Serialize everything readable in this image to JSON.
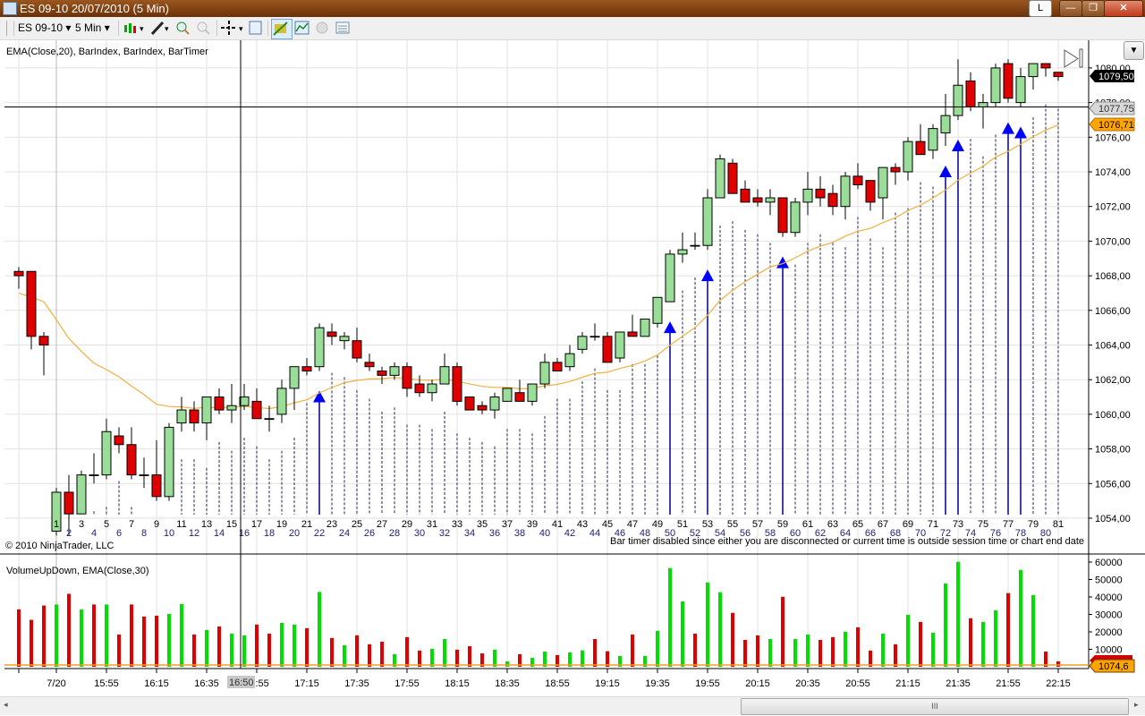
{
  "window": {
    "title": "ES 09-10  20/07/2010 (5 Min)",
    "link_button": "L",
    "minimize": "—",
    "restore": "❐",
    "close": "✕"
  },
  "toolbar": {
    "instrument": "ES 09-10",
    "interval": "5 Min",
    "dropdown_glyph": "▾",
    "icons": [
      "chart-style-icon",
      "drawing-tool-icon",
      "zoom-in-icon",
      "zoom-out-icon",
      "crosshair-icon",
      "properties-icon",
      "strategy-icon",
      "indicators-icon",
      "disabled-circle-icon",
      "data-box-icon"
    ]
  },
  "price_panel": {
    "indicator_label": "EMA(Close,20), BarIndex, BarIndex, BarTimer",
    "copyright": "© 2010 NinjaTrader, LLC",
    "bar_timer_message": "Bar timer disabled since either you are disconnected or current time is outside session time or chart end date",
    "axis_labels": [
      "1054,00",
      "1056,00",
      "1058,00",
      "1060,00",
      "1062,00",
      "1064,00",
      "1066,00",
      "1068,00",
      "1070,00",
      "1072,00",
      "1074,00",
      "1076,00",
      "1078,00",
      "1080,00"
    ],
    "last_price_label": "1079,50",
    "crosshair_price_label": "1077,75",
    "crosshair_price": 1077.75,
    "ema_label": "1076,71",
    "ema_start": 1067.0,
    "ema_period": 20
  },
  "volume_panel": {
    "label": "VolumeUpDown, EMA(Close,30)",
    "axis_labels": [
      "10000",
      "20000",
      "30000",
      "40000",
      "50000",
      "60000"
    ],
    "ema_label": "1074,6"
  },
  "time_axis": {
    "labels": [
      "7/20",
      "15:55",
      "16:15",
      "16:35",
      "16:55",
      "17:15",
      "17:35",
      "17:55",
      "18:15",
      "18:35",
      "18:55",
      "19:15",
      "19:35",
      "19:55",
      "20:15",
      "20:35",
      "20:55",
      "21:15",
      "21:35",
      "21:55",
      "22:15"
    ],
    "crosshair_time_label": "16:50"
  },
  "colors": {
    "up": "#99dd99",
    "down": "#e00000",
    "vol_up": "#00e000",
    "vol_down": "#e00000",
    "ema": "#f0b040",
    "arrow": "#0000ff",
    "title_bar": "#7a3f0c"
  },
  "chart_data": {
    "type": "candlestick",
    "ylim": [
      1053,
      1081
    ],
    "bar_index": [
      null,
      null,
      null,
      1,
      2,
      3,
      4,
      5,
      6,
      7,
      8,
      9,
      10,
      11,
      12,
      13,
      14,
      15,
      16,
      17,
      18,
      19,
      20,
      21,
      22,
      23,
      24,
      25,
      26,
      27,
      28,
      29,
      30,
      31,
      32,
      33,
      34,
      35,
      36,
      37,
      38,
      39,
      40,
      41,
      42,
      43,
      44,
      45,
      46,
      47,
      48,
      49,
      50,
      51,
      52,
      53,
      54,
      55,
      56,
      57,
      58,
      59,
      60,
      61,
      62,
      63,
      64,
      65,
      66,
      67,
      68,
      69,
      70,
      71,
      72,
      73,
      74,
      75,
      76,
      77,
      78,
      79,
      80,
      81
    ],
    "ohlc": [
      [
        1068.25,
        1068.5,
        1067.25,
        1068
      ],
      [
        1068.25,
        1068.25,
        1063.75,
        1064.5
      ],
      [
        1064.5,
        1064.75,
        1062.25,
        1064
      ],
      [
        1053.25,
        1055.75,
        1053,
        1055.5
      ],
      [
        1055.5,
        1056.5,
        1053,
        1054.25
      ],
      [
        1054.25,
        1056.75,
        1054.25,
        1056.5
      ],
      [
        1056.5,
        1057.75,
        1056,
        1056.5
      ],
      [
        1056.5,
        1059.75,
        1056.25,
        1059
      ],
      [
        1058.75,
        1059.25,
        1057.75,
        1058.25
      ],
      [
        1058.25,
        1059.25,
        1056.25,
        1056.5
      ],
      [
        1056.5,
        1057.5,
        1055.75,
        1056.5
      ],
      [
        1056.5,
        1058.5,
        1055,
        1055.25
      ],
      [
        1055.25,
        1059.5,
        1055,
        1059.25
      ],
      [
        1059.5,
        1061,
        1059,
        1060.25
      ],
      [
        1060.25,
        1060.75,
        1059,
        1059.5
      ],
      [
        1059.5,
        1061,
        1058.5,
        1061
      ],
      [
        1061,
        1061.5,
        1060,
        1060.25
      ],
      [
        1060.25,
        1061.75,
        1059.5,
        1060.5
      ],
      [
        1060.5,
        1061.75,
        1060.25,
        1061
      ],
      [
        1060.75,
        1061.5,
        1059.75,
        1059.75
      ],
      [
        1059.75,
        1060.5,
        1059,
        1059.75
      ],
      [
        1060,
        1062,
        1059.5,
        1061.5
      ],
      [
        1061.5,
        1062.75,
        1060.25,
        1062.75
      ],
      [
        1062.75,
        1063.25,
        1062.25,
        1062.5
      ],
      [
        1062.75,
        1065.25,
        1062.5,
        1065
      ],
      [
        1064.75,
        1065.25,
        1064,
        1064.5
      ],
      [
        1064.25,
        1064.75,
        1063.75,
        1064.5
      ],
      [
        1064.25,
        1065,
        1063,
        1063.25
      ],
      [
        1063,
        1063.5,
        1062.5,
        1062.75
      ],
      [
        1062.5,
        1062.75,
        1061.75,
        1062.25
      ],
      [
        1062.25,
        1063,
        1062,
        1062.75
      ],
      [
        1062.75,
        1063,
        1061,
        1061.5
      ],
      [
        1061.75,
        1062.25,
        1061,
        1061.25
      ],
      [
        1061.25,
        1062,
        1060.75,
        1061.75
      ],
      [
        1061.75,
        1063.5,
        1061.75,
        1062.75
      ],
      [
        1062.75,
        1063,
        1060.5,
        1060.75
      ],
      [
        1061,
        1061,
        1060.25,
        1060.25
      ],
      [
        1060.5,
        1060.75,
        1060,
        1060.25
      ],
      [
        1060.25,
        1061.25,
        1059.75,
        1061
      ],
      [
        1060.75,
        1061.5,
        1060.75,
        1061.5
      ],
      [
        1061.25,
        1062,
        1060.75,
        1060.75
      ],
      [
        1060.75,
        1061.75,
        1060.5,
        1061.75
      ],
      [
        1061.75,
        1063.5,
        1061.5,
        1063
      ],
      [
        1063,
        1063.25,
        1062.5,
        1062.5
      ],
      [
        1062.75,
        1064,
        1062.5,
        1063.5
      ],
      [
        1063.75,
        1064.75,
        1063.5,
        1064.5
      ],
      [
        1064.5,
        1065.25,
        1064.25,
        1064.5
      ],
      [
        1064.5,
        1064.75,
        1063,
        1063
      ],
      [
        1063.25,
        1064.75,
        1063,
        1064.75
      ],
      [
        1064.75,
        1065.75,
        1064.5,
        1064.5
      ],
      [
        1064.5,
        1065.5,
        1064.5,
        1065.5
      ],
      [
        1065.25,
        1066.75,
        1065,
        1066.75
      ],
      [
        1066.5,
        1069.5,
        1066.5,
        1069.25
      ],
      [
        1069.25,
        1070.5,
        1068.75,
        1069.5
      ],
      [
        1069.75,
        1070.5,
        1069.5,
        1069.75
      ],
      [
        1069.75,
        1073,
        1069.5,
        1072.5
      ],
      [
        1072.5,
        1075,
        1072.5,
        1074.75
      ],
      [
        1074.5,
        1074.75,
        1072.75,
        1072.75
      ],
      [
        1073,
        1073.5,
        1072.25,
        1072.25
      ],
      [
        1072.5,
        1073,
        1072,
        1072.25
      ],
      [
        1072.25,
        1073,
        1071.5,
        1072.5
      ],
      [
        1072.5,
        1072.5,
        1070.25,
        1070.5
      ],
      [
        1070.5,
        1072.5,
        1070.25,
        1072.25
      ],
      [
        1072.25,
        1074,
        1071.5,
        1073
      ],
      [
        1073,
        1073.75,
        1072,
        1072.5
      ],
      [
        1072.75,
        1073.25,
        1071.5,
        1072
      ],
      [
        1072,
        1074,
        1071.25,
        1073.75
      ],
      [
        1073.75,
        1074.5,
        1073,
        1073.25
      ],
      [
        1073.5,
        1073.5,
        1071.75,
        1072.25
      ],
      [
        1072.5,
        1074.25,
        1071.25,
        1074.25
      ],
      [
        1074.25,
        1074.5,
        1073.25,
        1074
      ],
      [
        1074,
        1076,
        1073.5,
        1075.75
      ],
      [
        1075.75,
        1076.75,
        1075,
        1075
      ],
      [
        1075.25,
        1076.75,
        1074.75,
        1076.5
      ],
      [
        1076.25,
        1078.5,
        1075.5,
        1077.25
      ],
      [
        1077.25,
        1080.5,
        1077,
        1079
      ],
      [
        1079.25,
        1079.75,
        1077.5,
        1077.75
      ],
      [
        1077.75,
        1078.5,
        1076.5,
        1078
      ],
      [
        1078,
        1080.25,
        1077.75,
        1080
      ],
      [
        1080.25,
        1080.5,
        1078,
        1078.25
      ],
      [
        1078,
        1080,
        1077.75,
        1079.5
      ],
      [
        1079.5,
        1080.25,
        1078.75,
        1080.25
      ],
      [
        1080.25,
        1080.25,
        1079.5,
        1080
      ],
      [
        1079.75,
        1079.75,
        1079.25,
        1079.5
      ]
    ],
    "signal_arrows_at_bar_index": [
      22,
      50,
      53,
      59,
      72,
      73,
      77,
      78
    ],
    "volume": [
      32900,
      26900,
      35100,
      35700,
      41800,
      32900,
      35700,
      35700,
      18500,
      35700,
      28800,
      29300,
      30300,
      36000,
      18500,
      21100,
      23100,
      19000,
      18000,
      24200,
      19000,
      25200,
      24200,
      22100,
      42900,
      16500,
      12300,
      18000,
      12900,
      14400,
      7200,
      17000,
      9300,
      10300,
      15900,
      9800,
      11800,
      7700,
      9800,
      3100,
      7200,
      5100,
      8700,
      6700,
      8200,
      9400,
      15900,
      8900,
      6200,
      18500,
      6200,
      20600,
      56600,
      37500,
      19000,
      48300,
      42700,
      30900,
      15400,
      18000,
      15900,
      40100,
      15900,
      18500,
      15400,
      17000,
      20100,
      22600,
      9300,
      19000,
      12900,
      29800,
      25700,
      19500,
      47800,
      60200,
      27800,
      25700,
      32400,
      42200,
      55500,
      41100,
      8700,
      3100
    ],
    "volume_ylim": [
      0,
      60000
    ]
  }
}
